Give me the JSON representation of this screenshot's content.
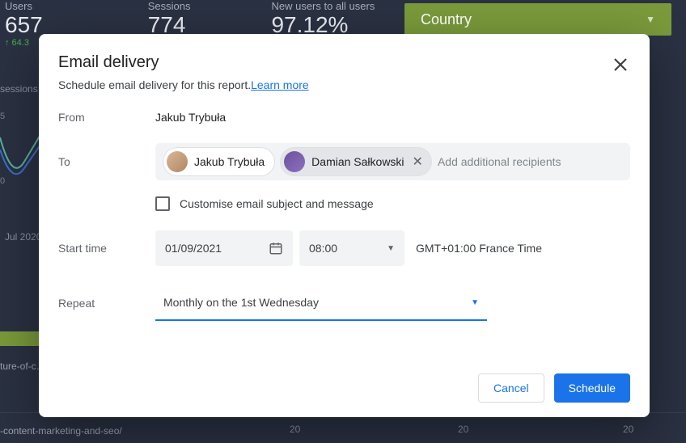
{
  "bg": {
    "metrics": {
      "users_label": "Users",
      "users_value": "657",
      "users_delta": "↑ 64.3",
      "sessions_label": "Sessions",
      "sessions_value": "774",
      "newusers_label": "New users to all users",
      "newusers_value": "97.12%"
    },
    "sessions_axis_label": "sessions",
    "country_label": "Country",
    "chart_month": "Jul 2020",
    "url1": "ture-of-c…",
    "url2": "-content-marketing-and-seo/",
    "tick1": "20",
    "tick2": "20",
    "tick3": "20",
    "axis_vals": [
      "5",
      "0"
    ]
  },
  "modal": {
    "title": "Email delivery",
    "subtitle_text": "Schedule email delivery for this report.",
    "subtitle_link": "Learn more",
    "from_label": "From",
    "from_value": "Jakub Trybuła",
    "to_label": "To",
    "recipients": [
      {
        "name": "Jakub Trybuła",
        "removable": false
      },
      {
        "name": "Damian Sałkowski",
        "removable": true
      }
    ],
    "to_placeholder": "Add additional recipients",
    "customise_label": "Customise email subject and message",
    "start_label": "Start time",
    "start_date": "01/09/2021",
    "start_time": "08:00",
    "timezone": "GMT+01:00 France Time",
    "repeat_label": "Repeat",
    "repeat_value": "Monthly on the 1st Wednesday",
    "cancel": "Cancel",
    "schedule": "Schedule"
  }
}
